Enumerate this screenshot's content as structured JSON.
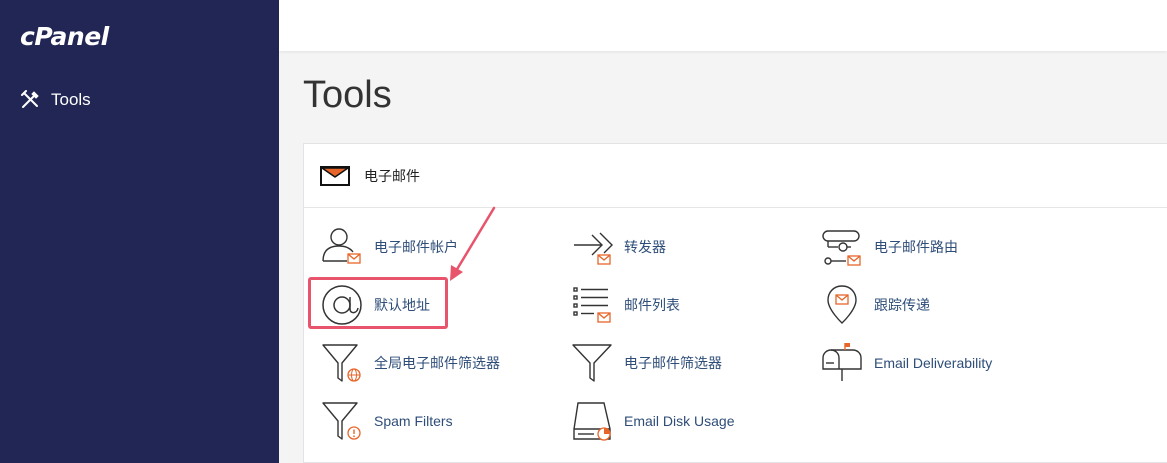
{
  "sidebar": {
    "logo": "cPanel",
    "items": [
      {
        "label": "Tools",
        "icon": "tools-icon"
      }
    ]
  },
  "main": {
    "title": "Tools",
    "section": {
      "title": "电子邮件",
      "icon": "envelope-icon",
      "tools": [
        {
          "label": "电子邮件帐户",
          "icon": "email-accounts-icon"
        },
        {
          "label": "转发器",
          "icon": "forwarders-icon"
        },
        {
          "label": "电子邮件路由",
          "icon": "email-routing-icon"
        },
        {
          "label": "默认地址",
          "icon": "at-sign-icon"
        },
        {
          "label": "邮件列表",
          "icon": "mailing-lists-icon"
        },
        {
          "label": "跟踪传递",
          "icon": "track-delivery-icon"
        },
        {
          "label": "全局电子邮件筛选器",
          "icon": "global-filter-icon"
        },
        {
          "label": "电子邮件筛选器",
          "icon": "filter-icon"
        },
        {
          "label": "Email Deliverability",
          "icon": "mailbox-icon"
        },
        {
          "label": "Spam Filters",
          "icon": "spam-filter-icon"
        },
        {
          "label": "Email Disk Usage",
          "icon": "disk-usage-icon"
        }
      ]
    }
  },
  "colors": {
    "sidebar_bg": "#222654",
    "link": "#2e4d78",
    "accent_orange": "#e8652a",
    "highlight": "#e8546b"
  }
}
